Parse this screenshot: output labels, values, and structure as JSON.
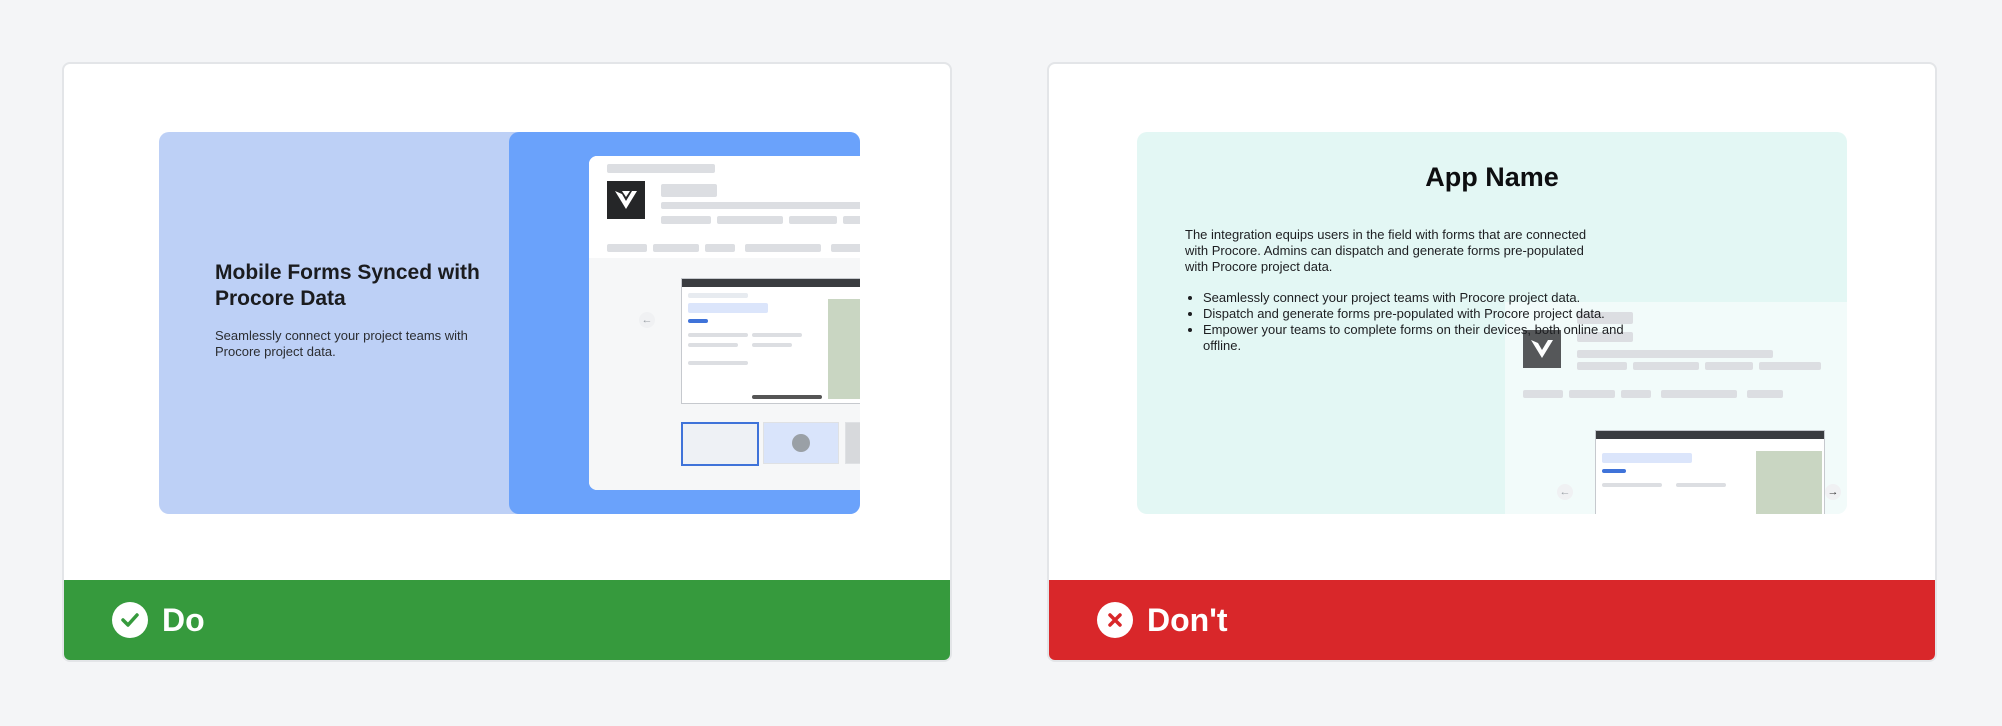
{
  "do_card": {
    "headline": "Mobile Forms Synced with Procore Data",
    "description": "Seamlessly connect your project teams with Procore project data.",
    "footer_label": "Do",
    "footer_color": "#369a3d",
    "icon": "check-circle-icon"
  },
  "dont_card": {
    "app_name": "App Name",
    "paragraph": "The integration equips users in the field with forms that are connected with Procore. Admins can dispatch and generate forms pre-populated with Procore project data.",
    "bullets": [
      "Seamlessly connect your project teams with Procore project data.",
      "Dispatch and generate forms pre-populated with Procore project data.",
      "Empower your teams to complete forms on their devices, both online and offline."
    ],
    "footer_label": "Don't",
    "footer_color": "#d9272a",
    "icon": "x-circle-icon"
  }
}
